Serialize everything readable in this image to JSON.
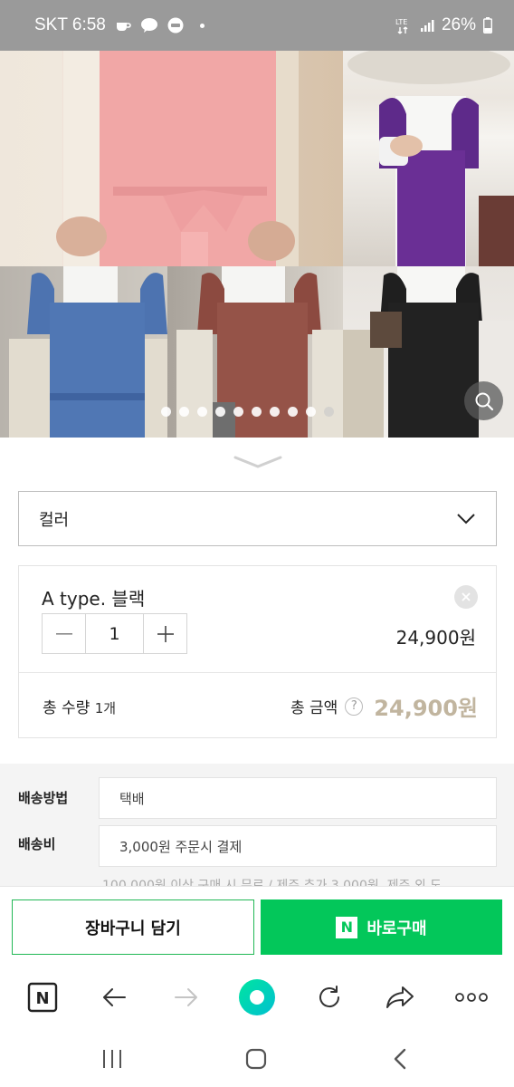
{
  "status_bar": {
    "carrier_time": "SKT 6:58",
    "network": "LTE",
    "battery": "26%"
  },
  "gallery": {
    "page_count": 10,
    "active_page": 10
  },
  "option_select": {
    "label": "컬러"
  },
  "selected_option": {
    "name": "A type. 블랙",
    "quantity": "1",
    "price": "24,900원"
  },
  "totals": {
    "quantity_label": "총 수량",
    "quantity_value": "1개",
    "amount_label": "총 금액",
    "help": "?",
    "amount_value": "24,900원"
  },
  "shipping": {
    "method_label": "배송방법",
    "method_value": "택배",
    "fee_label": "배송비",
    "fee_value": "3,000원 주문시 결제",
    "note": "100,000원 이상 구매 시 무료 / 제주 추가 3,000원, 제주 외 도"
  },
  "actions": {
    "cart_label": "장바구니 담기",
    "buy_icon": "N",
    "buy_label": "바로구매"
  },
  "browser_toolbar": {
    "home_icon": "N"
  },
  "colors": {
    "naver_green": "#03c75a",
    "total_amount": "#c1b59f",
    "status_bar": "#9a9a9a"
  }
}
